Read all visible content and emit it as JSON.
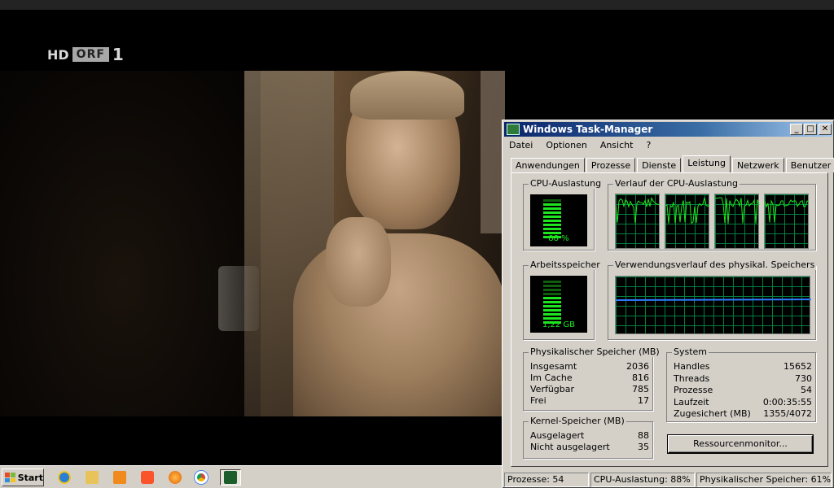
{
  "channel": {
    "hd": "HD",
    "name": "ORF",
    "number": "1"
  },
  "window": {
    "title": "Windows Task-Manager",
    "controls": {
      "minimize": "_",
      "maximize": "□",
      "close": "✕"
    }
  },
  "menu": [
    "Datei",
    "Optionen",
    "Ansicht",
    "?"
  ],
  "tabs": [
    "Anwendungen",
    "Prozesse",
    "Dienste",
    "Leistung",
    "Netzwerk",
    "Benutzer"
  ],
  "active_tab": "Leistung",
  "cpu": {
    "group_label": "CPU-Auslastung",
    "value_label": "88 %",
    "level_fraction": 0.88
  },
  "cpu_history": {
    "group_label": "Verlauf der CPU-Auslastung",
    "cores": 4
  },
  "memory": {
    "group_label": "Arbeitsspeicher",
    "value_label": "1,22 GB",
    "level_fraction": 0.61
  },
  "memory_history": {
    "group_label": "Verwendungsverlauf des physikal. Speichers",
    "level_fraction": 0.61
  },
  "physical": {
    "group_label": "Physikalischer Speicher (MB)",
    "rows": [
      {
        "label": "Insgesamt",
        "value": "2036"
      },
      {
        "label": "Im Cache",
        "value": "816"
      },
      {
        "label": "Verfügbar",
        "value": "785"
      },
      {
        "label": "Frei",
        "value": "17"
      }
    ]
  },
  "kernel": {
    "group_label": "Kernel-Speicher (MB)",
    "rows": [
      {
        "label": "Ausgelagert",
        "value": "88"
      },
      {
        "label": "Nicht ausgelagert",
        "value": "35"
      }
    ]
  },
  "system": {
    "group_label": "System",
    "rows": [
      {
        "label": "Handles",
        "value": "15652"
      },
      {
        "label": "Threads",
        "value": "730"
      },
      {
        "label": "Prozesse",
        "value": "54"
      },
      {
        "label": "Laufzeit",
        "value": "0:00:35:55"
      },
      {
        "label": "Zugesichert (MB)",
        "value": "1355/4072"
      }
    ]
  },
  "resmon_button": "Ressourcenmonitor...",
  "status": {
    "processes": "Prozesse: 54",
    "cpu": "CPU-Auslastung: 88%",
    "memory": "Physikalischer Speicher: 61%"
  },
  "taskbar": {
    "start_label": "Start",
    "icons": [
      "internet-explorer-icon",
      "file-explorer-icon",
      "media-player-icon",
      "brave-icon",
      "firefox-icon",
      "chrome-icon",
      "task-manager-icon"
    ]
  },
  "colors": {
    "meter_green": "#1ee61e",
    "grid_green": "#008040",
    "memory_line": "#2d7dff",
    "title_blue": "#0a246a"
  }
}
